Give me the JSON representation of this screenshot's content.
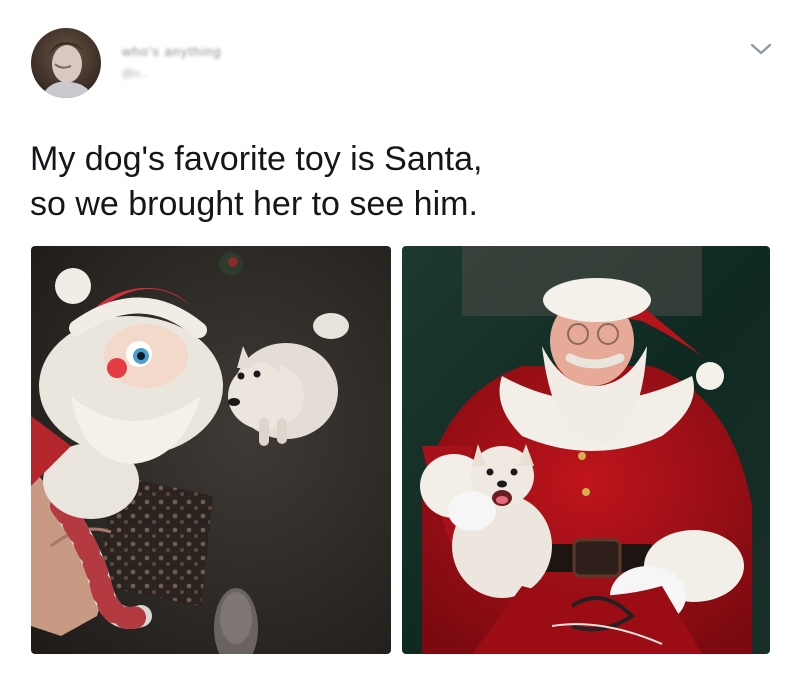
{
  "tweet": {
    "author_name": "who's anything",
    "author_handle": "@n...",
    "text_lines": [
      "My dog's favorite toy is Santa,",
      "so we brought her to see him."
    ]
  },
  "icons": {
    "menu": "chevron-down-icon",
    "avatar": "profile-avatar"
  },
  "colors": {
    "text": "#14171a",
    "muted": "#8a8a8a",
    "chevron": "#8899a6"
  }
}
